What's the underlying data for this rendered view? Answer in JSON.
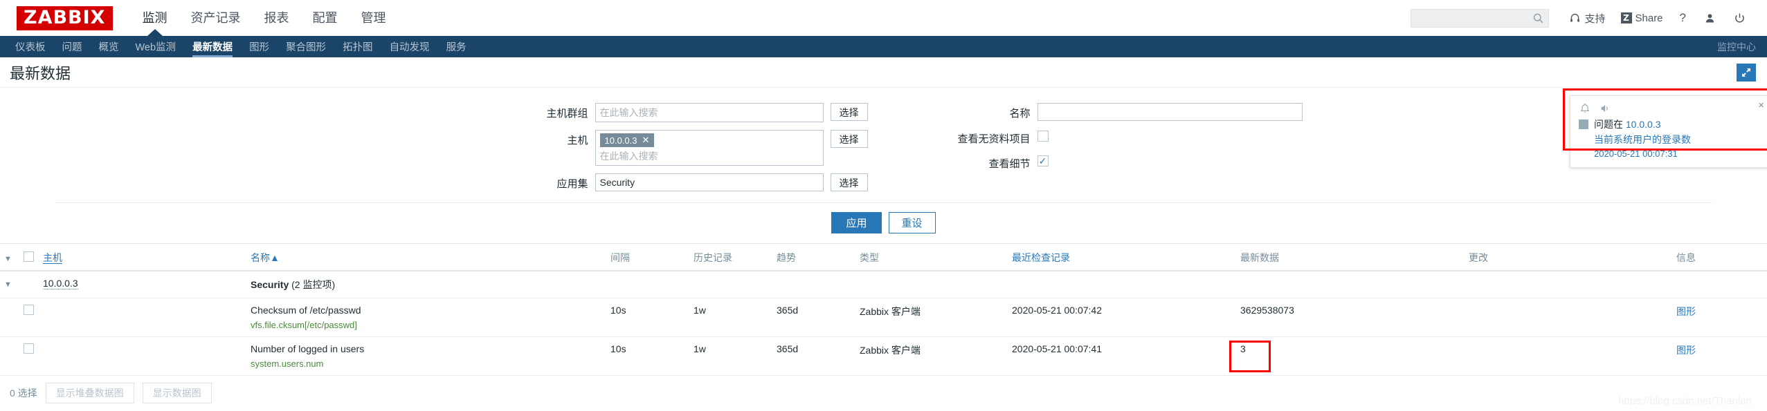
{
  "brand": {
    "logo": "ZABBIX"
  },
  "main_nav": [
    {
      "label": "监测",
      "active": true
    },
    {
      "label": "资产记录",
      "active": false
    },
    {
      "label": "报表",
      "active": false
    },
    {
      "label": "配置",
      "active": false
    },
    {
      "label": "管理",
      "active": false
    }
  ],
  "header_right": {
    "search_placeholder": "",
    "search_value": "",
    "support_label": "支持",
    "share_label": "Share",
    "share_badge": "Z",
    "help_label": "?"
  },
  "sub_nav": [
    {
      "label": "仪表板",
      "active": false
    },
    {
      "label": "问题",
      "active": false
    },
    {
      "label": "概览",
      "active": false
    },
    {
      "label": "Web监测",
      "active": false
    },
    {
      "label": "最新数据",
      "active": true
    },
    {
      "label": "图形",
      "active": false
    },
    {
      "label": "聚合图形",
      "active": false
    },
    {
      "label": "拓扑图",
      "active": false
    },
    {
      "label": "自动发现",
      "active": false
    },
    {
      "label": "服务",
      "active": false
    }
  ],
  "sub_nav_right": "监控中心",
  "page": {
    "title": "最新数据"
  },
  "filter": {
    "host_groups_label": "主机群组",
    "host_groups_placeholder": "在此输入搜索",
    "hosts_label": "主机",
    "hosts_tag": "10.0.0.3",
    "hosts_placeholder": "在此输入搜索",
    "applications_label": "应用集",
    "applications_value": "Security",
    "select_label": "选择",
    "name_label": "名称",
    "name_value": "",
    "show_without_data_label": "查看无资料项目",
    "show_without_data_checked": false,
    "show_details_label": "查看细节",
    "show_details_checked": true,
    "apply_label": "应用",
    "reset_label": "重设"
  },
  "table": {
    "headers": {
      "host": "主机",
      "name": "名称",
      "sort_arrow": "▲",
      "interval": "间隔",
      "history": "历史记录",
      "trends": "趋势",
      "type": "类型",
      "last_check": "最近检查记录",
      "last_value": "最新数据",
      "change": "更改",
      "info": "信息"
    },
    "group_row": {
      "host": "10.0.0.3",
      "application": "Security",
      "item_count": "(2 监控项)"
    },
    "rows": [
      {
        "name": "Checksum of /etc/passwd",
        "key": "vfs.file.cksum[/etc/passwd]",
        "interval": "10s",
        "history": "1w",
        "trends": "365d",
        "type": "Zabbix 客户端",
        "last_check": "2020-05-21 00:07:42",
        "last_value": "3629538073",
        "change": "",
        "info": "图形",
        "highlighted": false
      },
      {
        "name": "Number of logged in users",
        "key": "system.users.num",
        "interval": "10s",
        "history": "1w",
        "trends": "365d",
        "type": "Zabbix 客户端",
        "last_check": "2020-05-21 00:07:41",
        "last_value": "3",
        "change": "",
        "info": "图形",
        "highlighted": true
      }
    ]
  },
  "footer": {
    "selected_count": "0 选择",
    "stacked_graph_label": "显示堆叠数据图",
    "graph_label": "显示数据图"
  },
  "notification": {
    "problem_prefix": "问题在",
    "host": "10.0.0.3",
    "trigger": "当前系统用户的登录数",
    "time": "2020-05-21 00:07:31",
    "close_label": "×"
  },
  "watermark": "https://blog.csdn.net/Thanlon",
  "colors": {
    "brand_red": "#d40000",
    "nav_blue": "#1a4468",
    "link_blue": "#2878b8",
    "key_green": "#4a8a3c",
    "annotation_red": "#ff0000"
  }
}
